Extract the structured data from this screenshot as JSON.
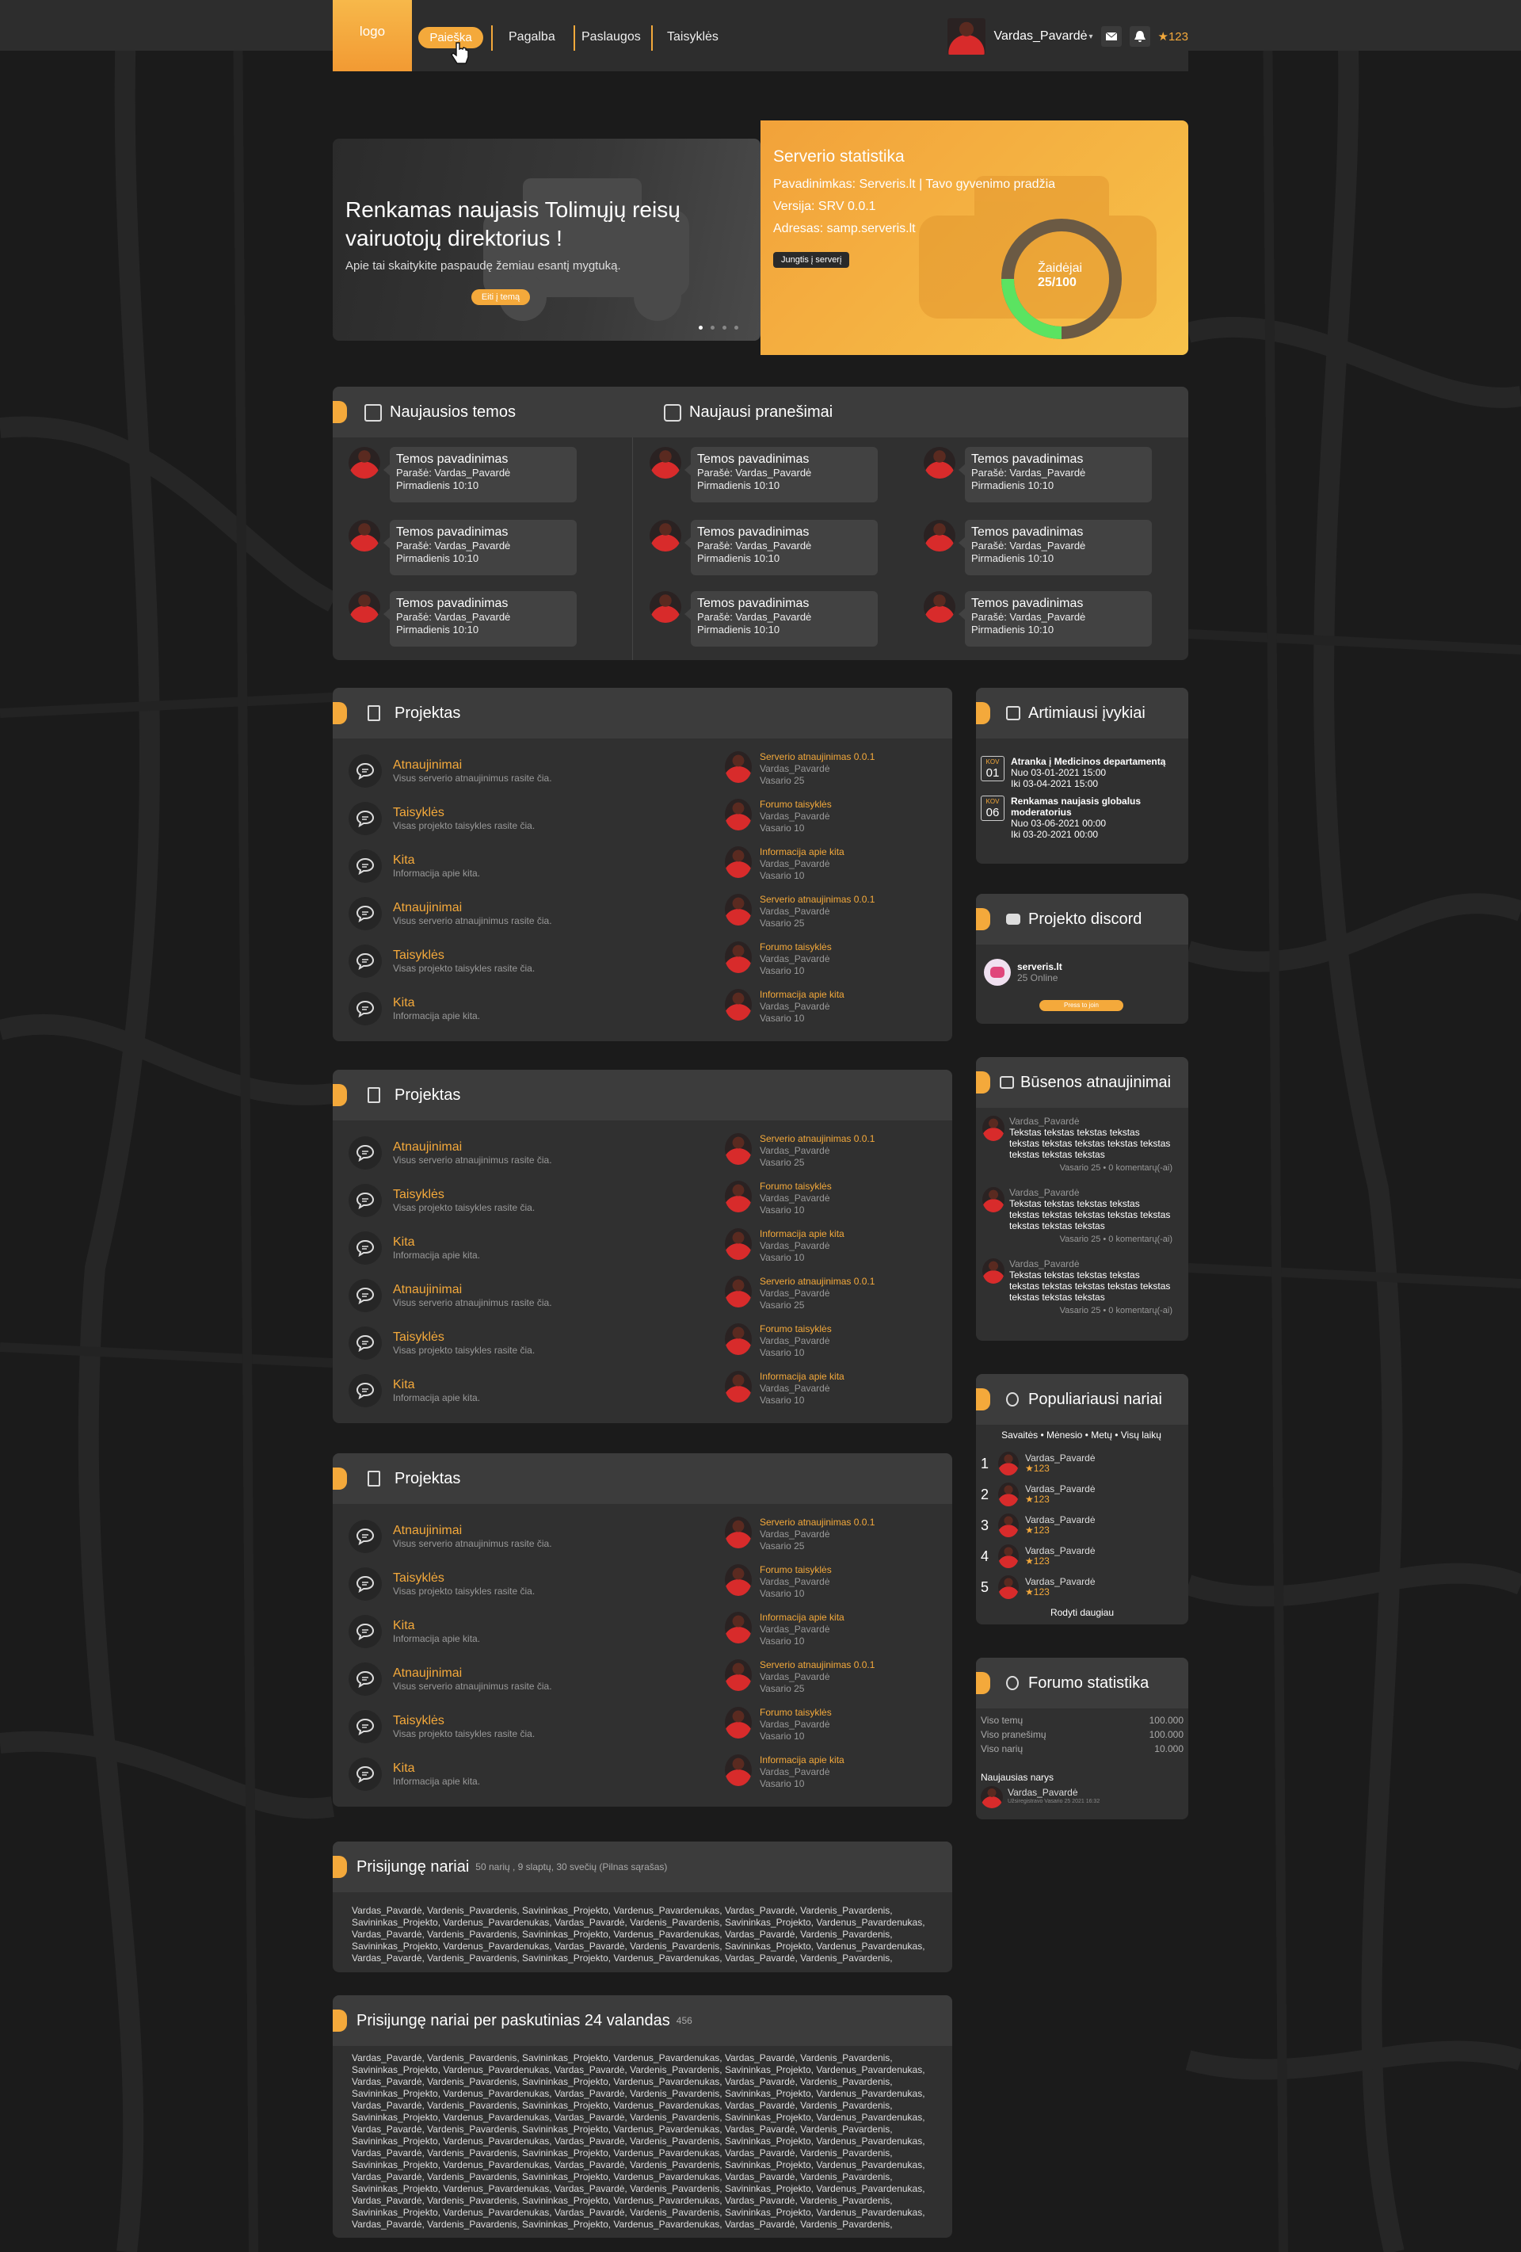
{
  "nav": {
    "logo": "logo",
    "items": [
      "Paieška",
      "Pagalba",
      "Paslaugos",
      "Taisyklės"
    ],
    "user_name": "Vardas_Pavardė",
    "points": "123"
  },
  "hero": {
    "title": "Renkamas naujasis Tolimųjų reisų vairuotojų direktorius !",
    "text": "Apie tai skaitykite paspaudę žemiau esantį mygtuką.",
    "button": "Eiti į temą"
  },
  "server": {
    "title": "Serverio statistika",
    "name": "Pavadinimkas: Serveris.lt | Tavo gyvenimo pradžia",
    "version": "Versija: SRV 0.0.1",
    "address": "Adresas: samp.serveris.lt",
    "join": "Jungtis į serverį",
    "players_label": "Žaidėjai",
    "players_value": "25/100",
    "players_online": 25,
    "players_max": 100,
    "accent": "#f4a93b",
    "ring_fill": "#5be361"
  },
  "latest": {
    "topics_title": "Naujausios temos",
    "posts_title": "Naujausi pranešimai",
    "item_title": "Temos pavadinimas",
    "item_author": "Parašė: Vardas_Pavardė",
    "item_time": "Pirmadienis 10:10"
  },
  "forum": {
    "title": "Projektas",
    "categories": [
      {
        "name": "Atnaujinimai",
        "desc": "Visus serverio atnaujinimus rasite čia.",
        "last_title": "Serverio atnaujinimas 0.0.1",
        "last_user": "Vardas_Pavardė",
        "last_date": "Vasario 25"
      },
      {
        "name": "Taisyklės",
        "desc": "Visas projekto taisykles rasite čia.",
        "last_title": "Forumo taisyklės",
        "last_user": "Vardas_Pavardė",
        "last_date": "Vasario 10"
      },
      {
        "name": "Kita",
        "desc": "Informacija apie kita.",
        "last_title": "Informacija apie kita",
        "last_user": "Vardas_Pavardė",
        "last_date": "Vasario 10"
      },
      {
        "name": "Atnaujinimai",
        "desc": "Visus serverio atnaujinimus rasite čia.",
        "last_title": "Serverio atnaujinimas 0.0.1",
        "last_user": "Vardas_Pavardė",
        "last_date": "Vasario 25"
      },
      {
        "name": "Taisyklės",
        "desc": "Visas projekto taisykles rasite čia.",
        "last_title": "Forumo taisyklės",
        "last_user": "Vardas_Pavardė",
        "last_date": "Vasario 10"
      },
      {
        "name": "Kita",
        "desc": "Informacija apie kita.",
        "last_title": "Informacija apie kita",
        "last_user": "Vardas_Pavardė",
        "last_date": "Vasario 10"
      }
    ]
  },
  "events": {
    "title": "Artimiausi įvykiai",
    "items": [
      {
        "month": "KOV",
        "day": "01",
        "title": "Atranka į Medicinos departamentą",
        "from": "Nuo 03-01-2021 15:00",
        "to": "Iki 03-04-2021 15:00"
      },
      {
        "month": "KOV",
        "day": "06",
        "title": "Renkamas naujasis globalus moderatorius",
        "from": "Nuo 03-06-2021 00:00",
        "to": "Iki 03-20-2021 00:00"
      }
    ]
  },
  "discord": {
    "title": "Projekto discord",
    "server": "serveris.lt",
    "online": "25 Online",
    "button": "Press to join"
  },
  "status_updates": {
    "title": "Būsenos atnaujinimai",
    "user": "Vardas_Pavardė",
    "text": "Tekstas tekstas tekstas tekstas tekstas tekstas tekstas tekstas tekstas tekstas tekstas tekstas",
    "meta": "Vasario 25 • 0 komentarų(-ai)"
  },
  "popular": {
    "title": "Populiariausi nariai",
    "filters": "Savaitės  •  Mėnesio  •  Metų  •  Visų laikų",
    "user": "Vardas_Pavardė",
    "points": "123",
    "ranks": [
      "1",
      "2",
      "3",
      "4",
      "5"
    ],
    "more": "Rodyti daugiau"
  },
  "stats": {
    "title": "Forumo statistika",
    "rows": [
      {
        "label": "Viso temų",
        "value": "100.000"
      },
      {
        "label": "Viso pranešimų",
        "value": "100.000"
      },
      {
        "label": "Viso narių",
        "value": "10.000"
      }
    ],
    "newest_label": "Naujausias narys",
    "newest_user": "Vardas_Pavardė",
    "newest_meta": "Užsiregistravo Vasario 25 2021 16:32"
  },
  "online": {
    "title": "Prisijungę nariai",
    "count": "50 narių , 9 slaptų, 30 svečių (Pilnas sąrašas)",
    "line": "Vardas_Pavardė, Vardenis_Pavardenis, Savininkas_Projekto, Vardenus_Pavardenukas, Vardas_Pavardė, Vardenis_Pavardenis,",
    "line2": "Savininkas_Projekto, Vardenus_Pavardenukas, Vardas_Pavardė, Vardenis_Pavardenis, Savininkas_Projekto, Vardenus_Pavardenukas,"
  },
  "online24": {
    "title": "Prisijungę nariai per paskutinias 24 valandas",
    "count": "456"
  }
}
